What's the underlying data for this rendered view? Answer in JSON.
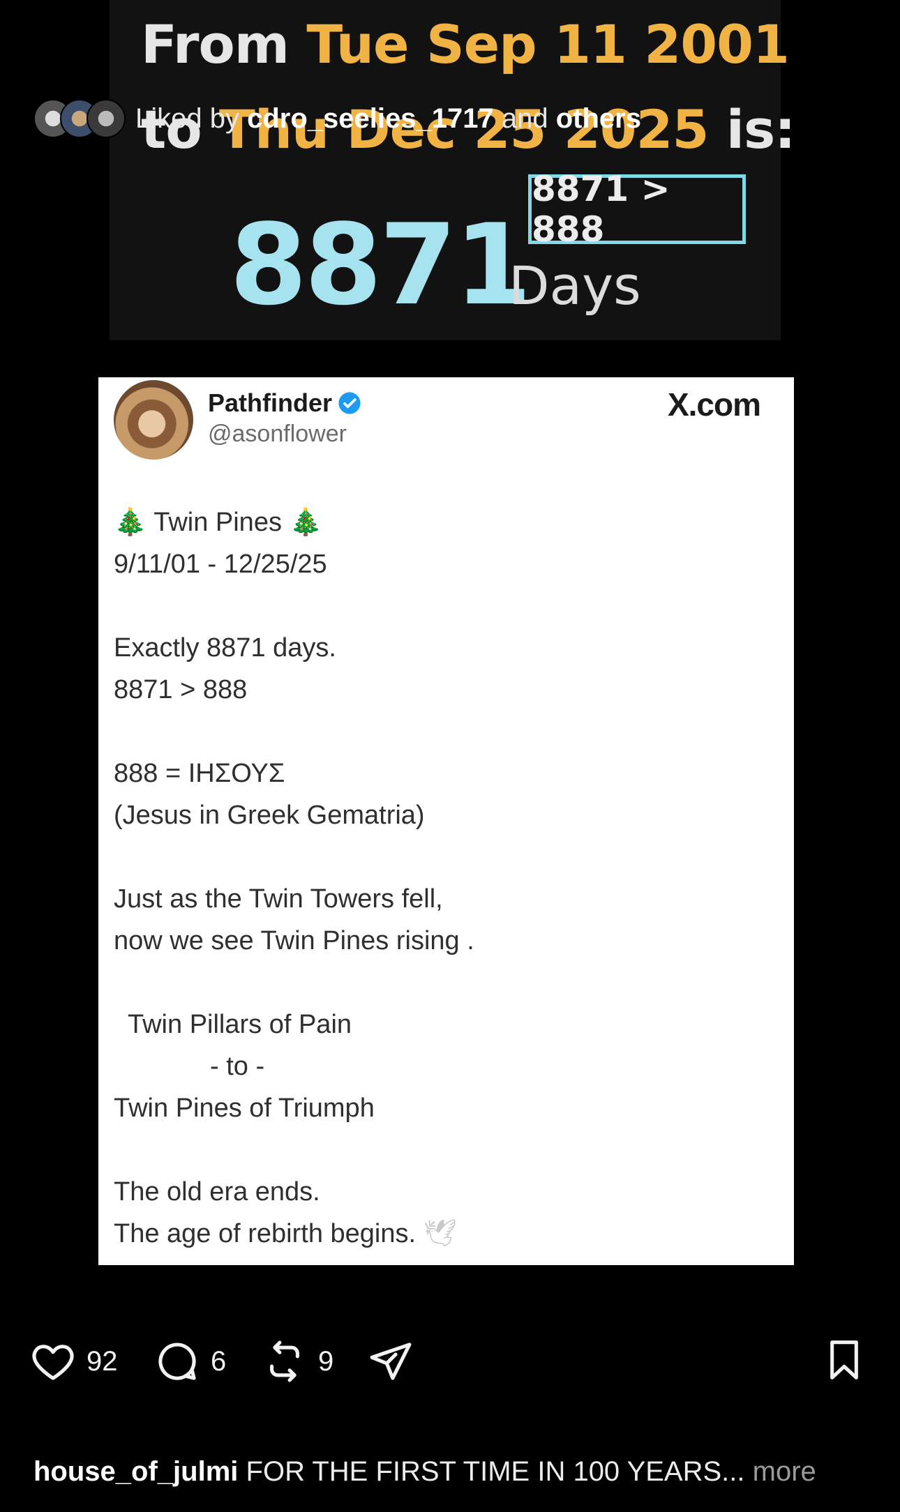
{
  "banner": {
    "line1_from": "From",
    "line1_date": "Tue Sep 11 2001",
    "line2_to": "to",
    "line2_date": "Thu Dec 25 2025",
    "line2_is": "is:",
    "box_text": "8871 > 888",
    "big_number": "8871",
    "unit": "Days"
  },
  "tweet": {
    "author_name": "Pathfinder",
    "handle": "@asonflower",
    "source": "X.com",
    "lines": {
      "title": "Twin Pines",
      "dates": "9/11/01 - 12/25/25",
      "exact": "Exactly 8871 days.",
      "compare": "8871 > 888",
      "greek": "888 = ΙΗΣΟΥΣ",
      "greek_note": "(Jesus in Greek Gematria)",
      "towers": "Just as the Twin Towers fell,",
      "pines_rising": "now we see Twin Pines rising .",
      "pillars": "Twin Pillars of Pain",
      "to": "- to -",
      "triumph": "Twin Pines of Triumph",
      "era": "The old era ends.",
      "rebirth": "The age of rebirth begins."
    },
    "icons": {
      "tree": "🎄",
      "dove": "🕊"
    }
  },
  "actions": {
    "likes": "92",
    "comments": "6",
    "reposts": "9"
  },
  "liked_by": {
    "prefix": "Liked by",
    "user": "cdro_seelies_1717",
    "and": "and",
    "others": "others"
  },
  "caption": {
    "user": "house_of_julmi",
    "text": "FOR THE FIRST TIME IN 100 YEARS...",
    "more": "more"
  },
  "colors": {
    "accent_yellow": "#f1b444",
    "accent_cyan": "#a6e3ef",
    "verified_blue": "#1d9bf0"
  }
}
